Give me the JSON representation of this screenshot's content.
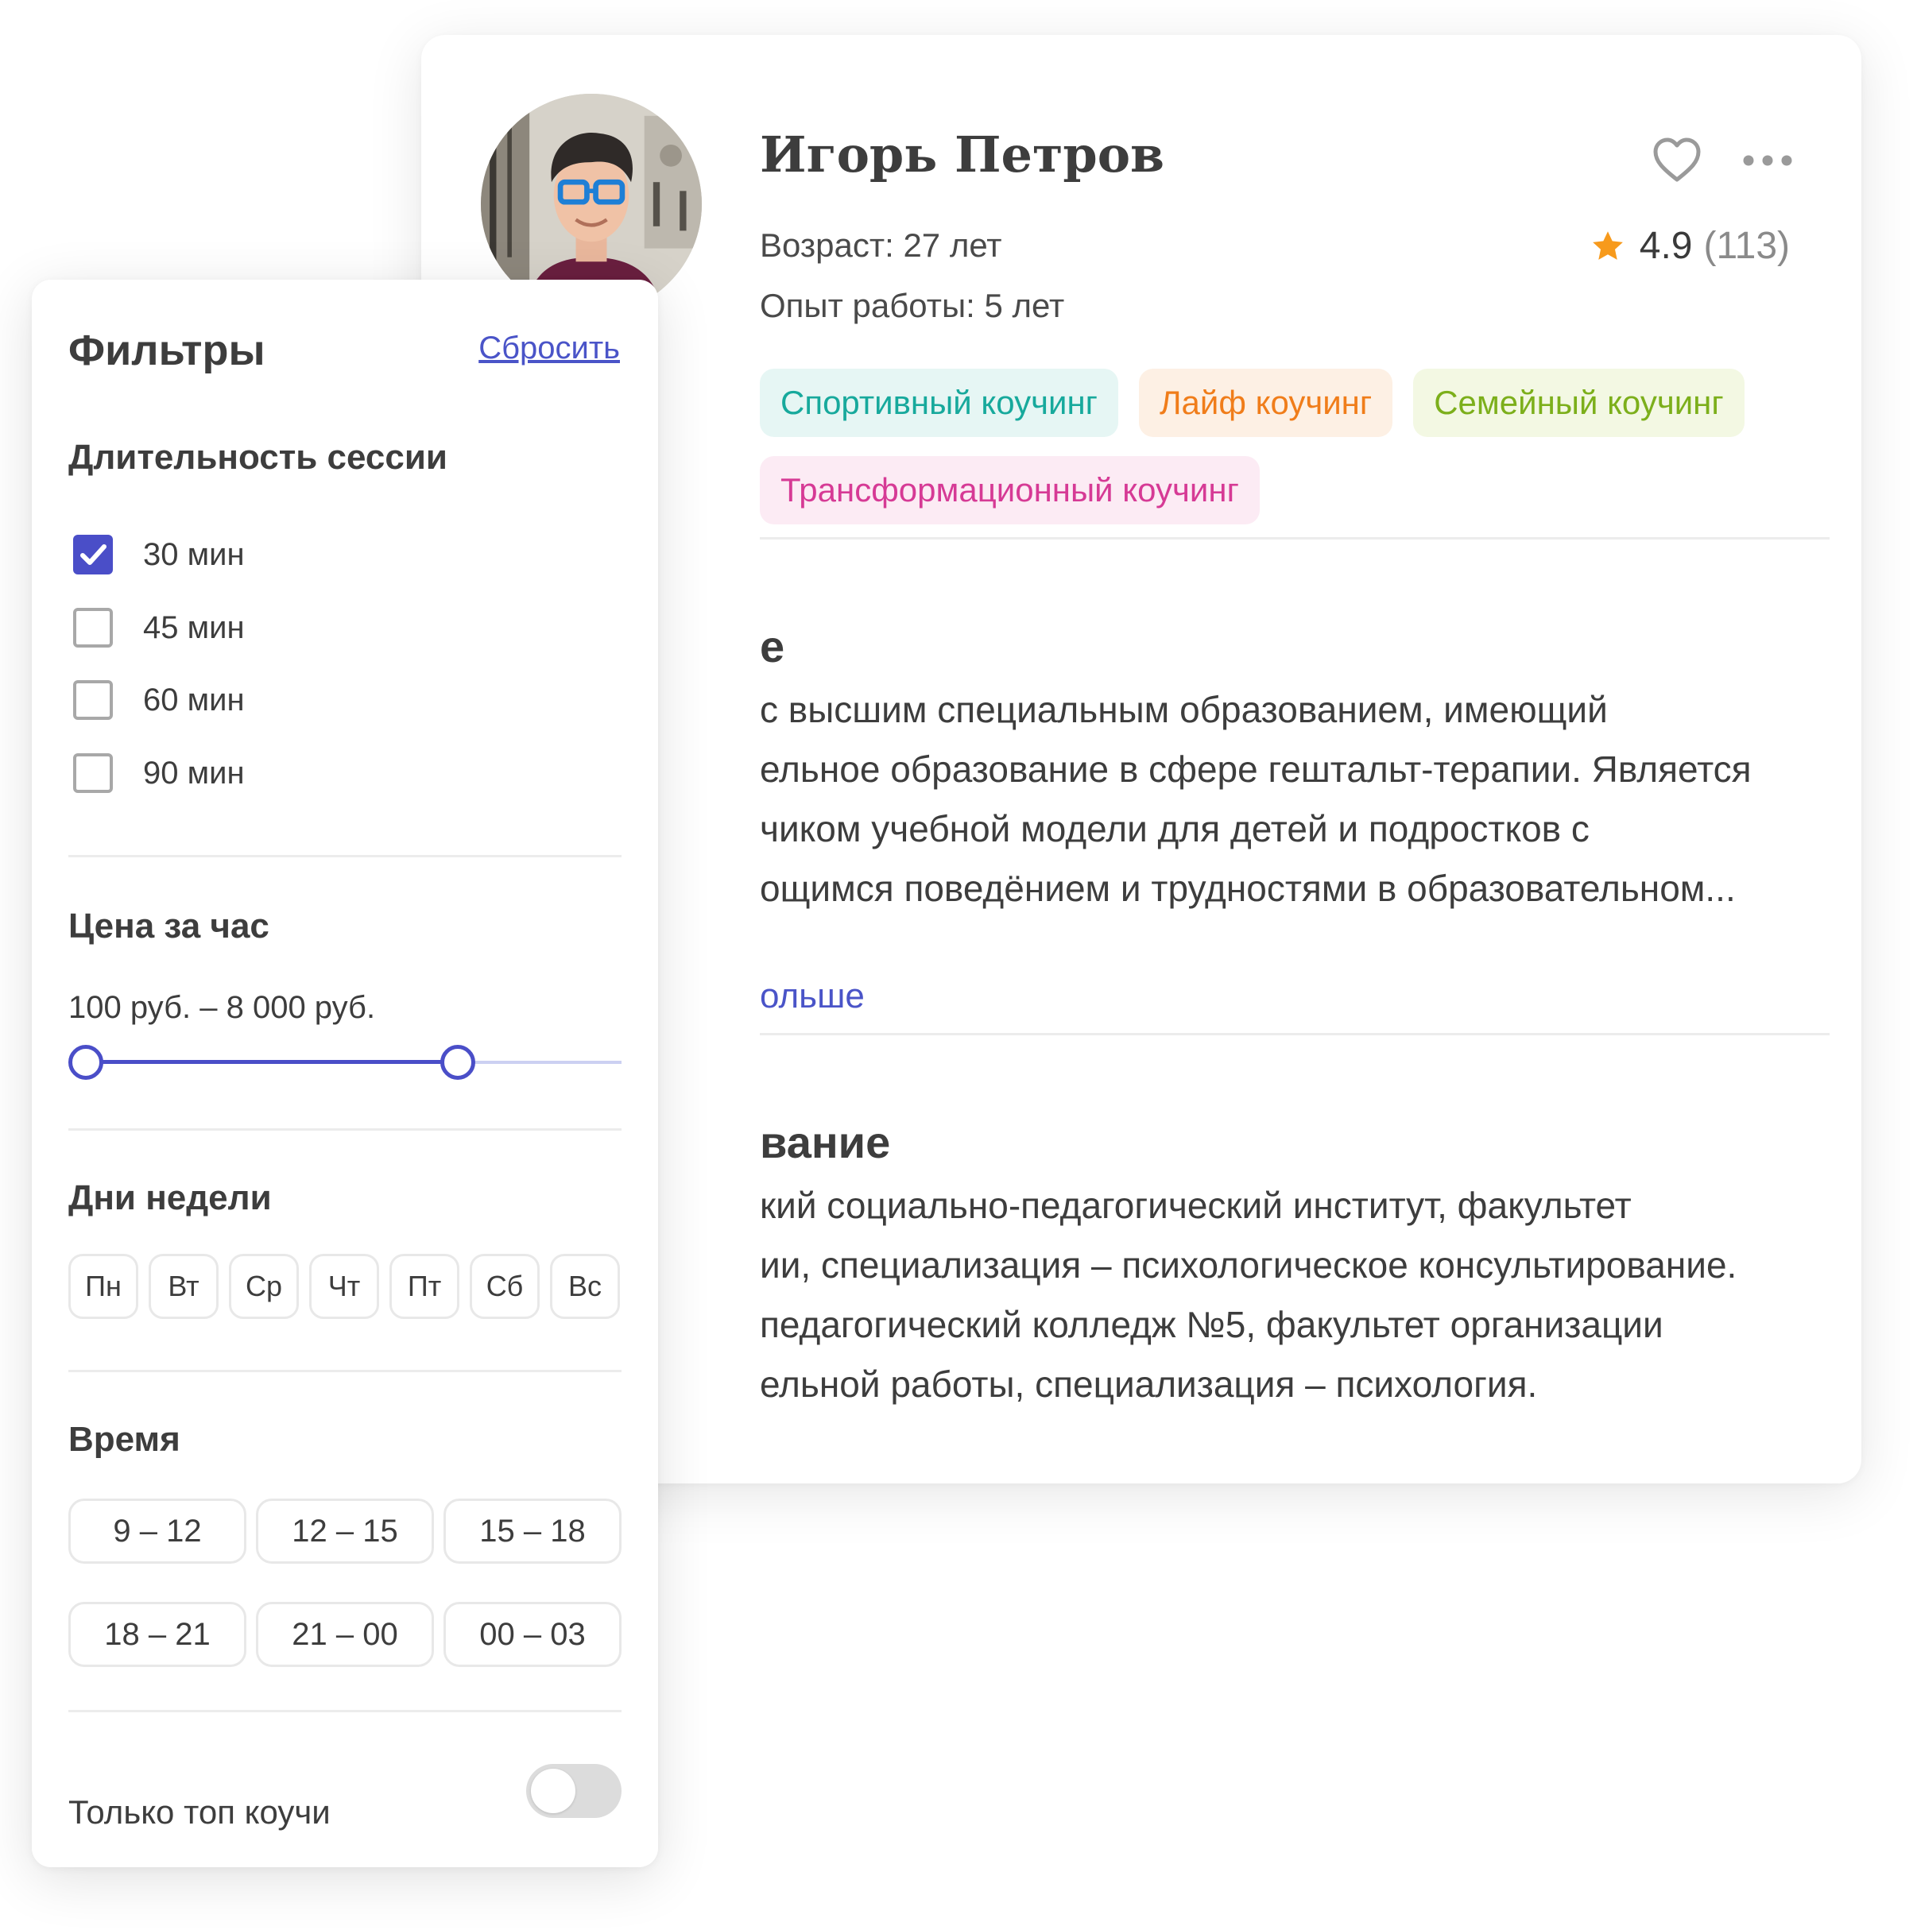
{
  "profile": {
    "name": "Игорь Петров",
    "age": "Возраст: 27 лет",
    "experience": "Опыт работы: 5 лет",
    "rating": "4.9",
    "reviews": "(113)",
    "tags": [
      "Спортивный коучинг",
      "Лайф коучинг",
      "Семейный коучинг",
      "Трансформационный коучинг"
    ],
    "about": {
      "title_visible": "е",
      "lines": [
        "с высшим специальным образованием, имеющий",
        "ельное образование в сфере гештальт-терапии. Является",
        "чиком учебной модели для детей и подростков с",
        "ощимся поведёнием и трудностями в образовательном..."
      ],
      "more_link": "ольше"
    },
    "education": {
      "title_visible": "вание",
      "lines": [
        "кий социально-педагогический институт, факультет",
        "ии, специализация – психологическое консультирование.",
        "педагогический колледж №5, факультет организации",
        "ельной работы, специализация – психология."
      ]
    },
    "icons": {
      "favorite": "heart-icon",
      "more": "more-dots-icon",
      "star": "star-icon",
      "star_color": "#F79A1C"
    }
  },
  "filters": {
    "title": "Фильтры",
    "reset": "Сбросить",
    "duration": {
      "title": "Длительность сессии",
      "options": [
        {
          "label": "30 мин",
          "checked": true
        },
        {
          "label": "45 мин",
          "checked": false
        },
        {
          "label": "60 мин",
          "checked": false
        },
        {
          "label": "90 мин",
          "checked": false
        }
      ]
    },
    "price": {
      "title": "Цена за час",
      "range": "100 руб. – 8 000 руб.",
      "min_fraction": 0,
      "max_fraction": 0.68
    },
    "days": {
      "title": "Дни недели",
      "items": [
        "Пн",
        "Вт",
        "Ср",
        "Чт",
        "Пт",
        "Сб",
        "Вс"
      ]
    },
    "time": {
      "title": "Время",
      "slots": [
        "9 – 12",
        "12 – 15",
        "15 – 18",
        "18 – 21",
        "21 – 00",
        "00 – 03"
      ]
    },
    "top_only": {
      "label": "Только топ коучи",
      "enabled": false
    }
  },
  "colors": {
    "accent": "#4A4EC8",
    "text": "#3D3D3D",
    "tag_sport": "#17A99C",
    "tag_life": "#F07D1A",
    "tag_family": "#7CAF1B",
    "tag_transform": "#D63A95"
  }
}
